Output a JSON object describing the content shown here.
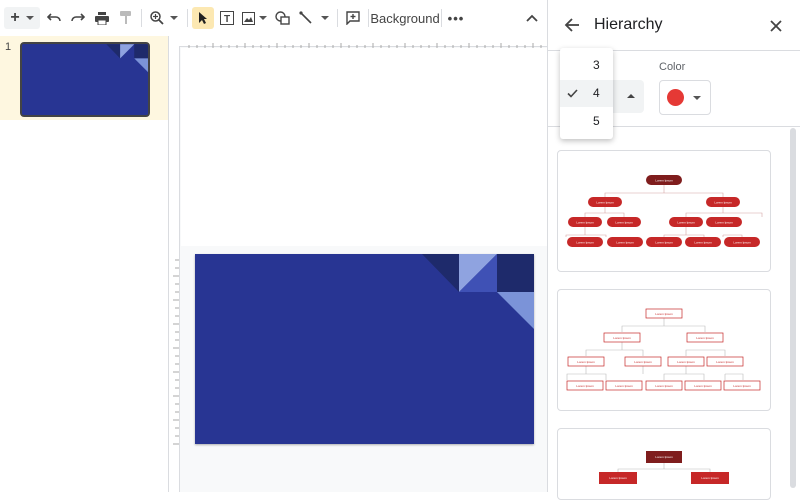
{
  "toolbar": {
    "background_label": "Background"
  },
  "filmstrip": {
    "slide_number": "1"
  },
  "panel": {
    "title": "Hierarchy",
    "color_label": "Color",
    "selected_color": "#e53935",
    "levels": [
      "3",
      "4",
      "5"
    ],
    "selected_level": "4"
  },
  "node_text": "Lorem Ipsum",
  "colors": {
    "slide_bg": "#283593",
    "accent": "#fce8b2",
    "node_dark": "#7f1d1d",
    "node_red": "#c62828"
  }
}
